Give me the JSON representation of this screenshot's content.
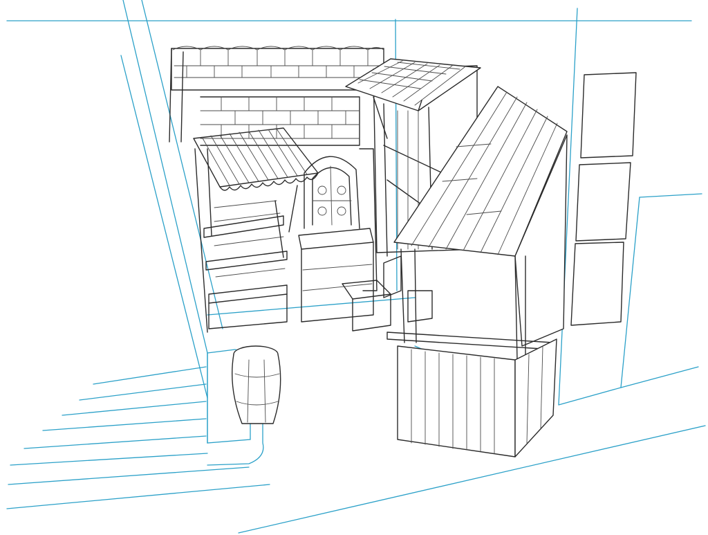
{
  "image": {
    "kind": "pencil-sketch",
    "subject": "market-alley-with-stalls",
    "colors": {
      "background": "#ffffff",
      "perspective_guides": "#2aa0c8",
      "pencil": "#2a2a2a"
    }
  }
}
